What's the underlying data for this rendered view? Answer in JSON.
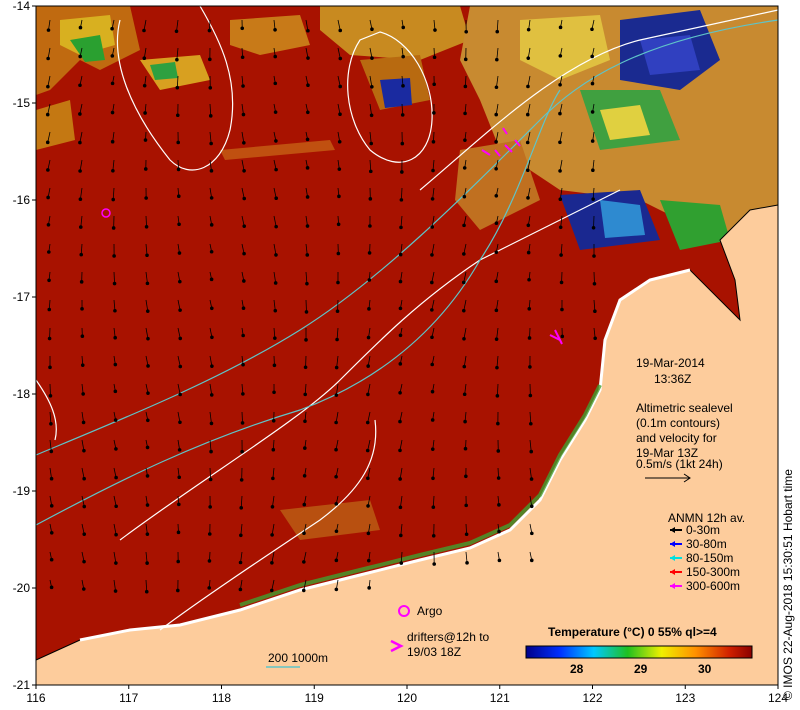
{
  "map": {
    "x_ticks": [
      "116",
      "117",
      "118",
      "119",
      "120",
      "121",
      "122",
      "123",
      "124"
    ],
    "y_ticks": [
      "-14",
      "-15",
      "-16",
      "-17",
      "-18",
      "-19",
      "-20",
      "-21"
    ],
    "lon_range": [
      116,
      124
    ],
    "lat_range": [
      -21,
      -14
    ]
  },
  "date": "19-Mar-2014",
  "time": "13:36Z",
  "altimetry_lines": [
    "Altimetric sealevel",
    "(0.1m contours)",
    "and velocity for",
    "19-Mar 13Z",
    "0.5m/s (1kt 24h)"
  ],
  "anmn": {
    "title": "ANMN 12h av.",
    "items": [
      {
        "label": "0-30m",
        "color": "#000000"
      },
      {
        "label": "30-80m",
        "color": "#0000ff"
      },
      {
        "label": "80-150m",
        "color": "#00e0e0"
      },
      {
        "label": "150-300m",
        "color": "#ff0000"
      },
      {
        "label": "300-600m",
        "color": "#ff00ff"
      }
    ]
  },
  "argo_label": "Argo",
  "drifters_label": [
    "drifters@12h to",
    "19/03 18Z"
  ],
  "bathy_label": "200  1000m",
  "colorbar": {
    "title": "Temperature (°C) 0 55% ql>=4",
    "ticks": [
      "28",
      "29",
      "30"
    ]
  },
  "credit": "© IMOS 22-Aug-2018 15:30:51 Hobart time",
  "colors": {
    "ocean": "#a81200",
    "land": "#fdcc9c",
    "contour_white": "#ffffff",
    "contour_cyan": "#5fc4c8",
    "argo": "#ff00ff"
  }
}
